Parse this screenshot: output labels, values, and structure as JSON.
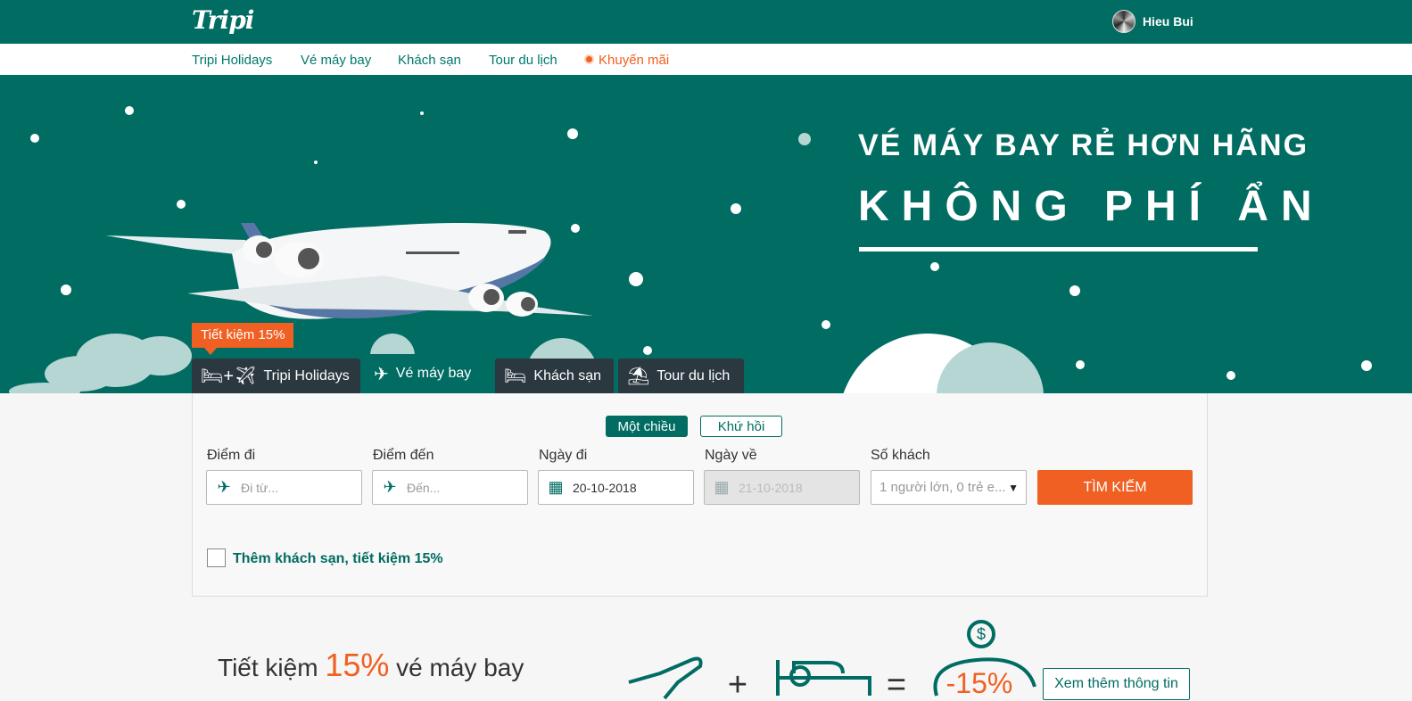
{
  "header": {
    "logo": "Tripi",
    "user_name": "Hieu Bui"
  },
  "nav": {
    "items": [
      "Tripi Holidays",
      "Vé máy bay",
      "Khách sạn",
      "Tour du lịch"
    ],
    "promo": "Khuyến mãi"
  },
  "hero": {
    "headline1": "VÉ MÁY BAY RẺ HƠN HÃNG",
    "headline2": "KHÔNG PHÍ ẨN"
  },
  "search": {
    "save_badge": "Tiết kiệm 15%",
    "tabs": [
      {
        "label": "Tripi Holidays",
        "icon": "bed-plus-plane-icon"
      },
      {
        "label": "Vé máy bay",
        "icon": "plane-icon"
      },
      {
        "label": "Khách sạn",
        "icon": "bed-icon"
      },
      {
        "label": "Tour du lịch",
        "icon": "umbrella-ball-icon"
      }
    ],
    "active_tab": "Vé máy bay",
    "trip_types": [
      "Một chiều",
      "Khứ hồi"
    ],
    "selected_trip_type": "Một chiều",
    "fields": {
      "from": {
        "label": "Điểm đi",
        "placeholder": "Đi từ..."
      },
      "to": {
        "label": "Điểm đến",
        "placeholder": "Đến..."
      },
      "depart": {
        "label": "Ngày đi",
        "value": "20-10-2018"
      },
      "return": {
        "label": "Ngày về",
        "value": "21-10-2018"
      },
      "guests": {
        "label": "Số khách",
        "value": "1 người lớn, 0 trẻ e..."
      }
    },
    "search_button": "TÌM KIẾM",
    "add_hotel_label": "Thêm khách sạn, tiết kiệm 15%"
  },
  "promo": {
    "text_prefix": "Tiết kiệm",
    "percent": "15%",
    "text_suffix": "vé máy bay",
    "discount": "-15%",
    "more_button": "Xem thêm thông tin"
  },
  "colors": {
    "brand": "#006c62",
    "accent": "#f06022",
    "tab_dark": "#2c3840"
  }
}
